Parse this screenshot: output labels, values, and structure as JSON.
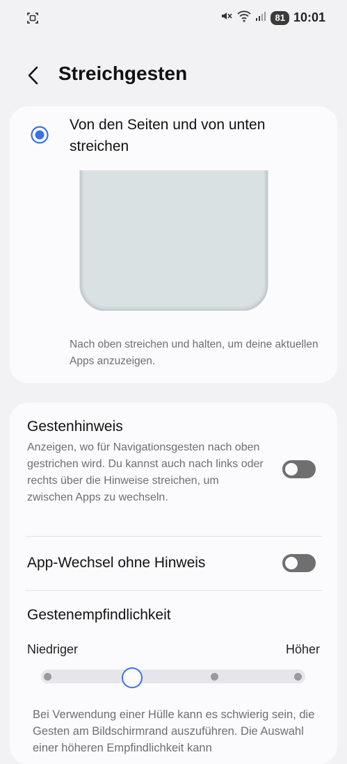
{
  "status_bar": {
    "time": "10:01",
    "battery": "81",
    "icons": [
      "screenshot-icon",
      "mute-icon",
      "wifi-icon",
      "signal-icon"
    ]
  },
  "header": {
    "title": "Streichgesten",
    "back_icon": "back-arrow-icon"
  },
  "option": {
    "label": "Von den Seiten und von unten streichen",
    "selected": true,
    "hint": "Nach oben streichen und halten, um deine aktuellen Apps anzuzeigen."
  },
  "gesture_hint": {
    "title": "Gestenhinweis",
    "description": "Anzeigen, wo für Navigationsgesten nach oben gestrichen wird. Du kannst auch nach links oder rechts über die Hinweise streichen, um zwischen Apps zu wechseln.",
    "enabled": false
  },
  "app_switch": {
    "title": "App-Wechsel ohne Hinweis",
    "enabled": false
  },
  "sensitivity": {
    "title": "Gestenempfindlichkeit",
    "low_label": "Niedriger",
    "high_label": "Höher",
    "steps": 4,
    "selected_step": 2,
    "note": "Bei Verwendung einer Hülle kann es schwierig sein, die Gesten am Bildschirmrand auszuführen. Die Auswahl einer höheren Empfindlichkeit kann"
  },
  "colors": {
    "accent": "#3a73e6",
    "background": "#f2f2f5",
    "card": "#fbfbfd",
    "secondary_text": "#6e6e73"
  }
}
